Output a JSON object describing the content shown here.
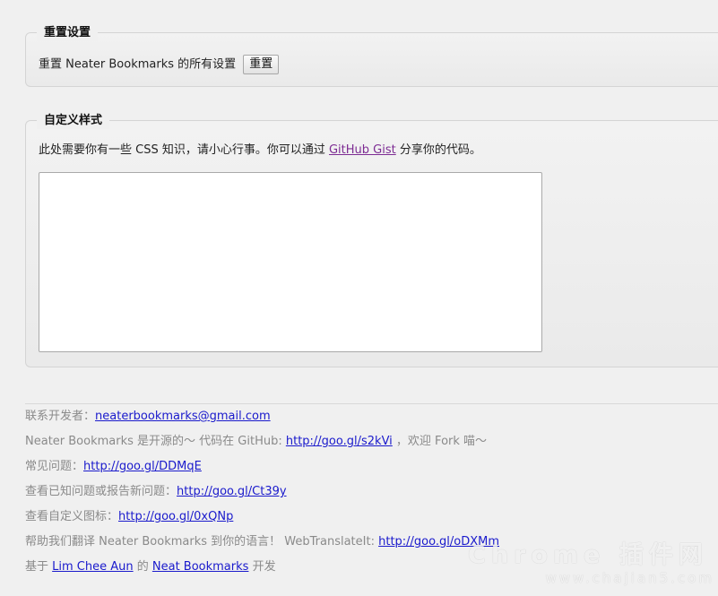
{
  "reset_section": {
    "legend": "重置设置",
    "description": "重置 Neater Bookmarks 的所有设置",
    "button_label": "重置"
  },
  "custom_style_section": {
    "legend": "自定义样式",
    "description_prefix": "此处需要你有一些 CSS 知识，请小心行事。你可以通过 ",
    "link_text": "GitHub Gist",
    "description_suffix": " 分享你的代码。",
    "css_value": ""
  },
  "footer": {
    "contact": {
      "label": "联系开发者：",
      "link": "neaterbookmarks@gmail.com"
    },
    "opensource": {
      "label": "Neater Bookmarks 是开源的～ 代码在 GitHub: ",
      "link": "http://goo.gl/s2kVi",
      "suffix": " ，欢迎 Fork 喵～"
    },
    "faq": {
      "label": "常见问题：",
      "link": "http://goo.gl/DDMqE"
    },
    "issues": {
      "label": "查看已知问题或报告新问题：",
      "link": "http://goo.gl/Ct39y"
    },
    "icons": {
      "label": "查看自定义图标：",
      "link": "http://goo.gl/0xQNp"
    },
    "translate": {
      "label": "帮助我们翻译 Neater Bookmarks 到你的语言！ WebTranslateIt: ",
      "link": "http://goo.gl/oDXMm"
    },
    "credits": {
      "prefix": "基于 ",
      "author": "Lim Chee Aun",
      "middle": " 的 ",
      "project": "Neat Bookmarks",
      "suffix": " 开发"
    }
  },
  "watermark": {
    "main": "Chrome 插件网",
    "sub": "www.chajian5.com"
  }
}
